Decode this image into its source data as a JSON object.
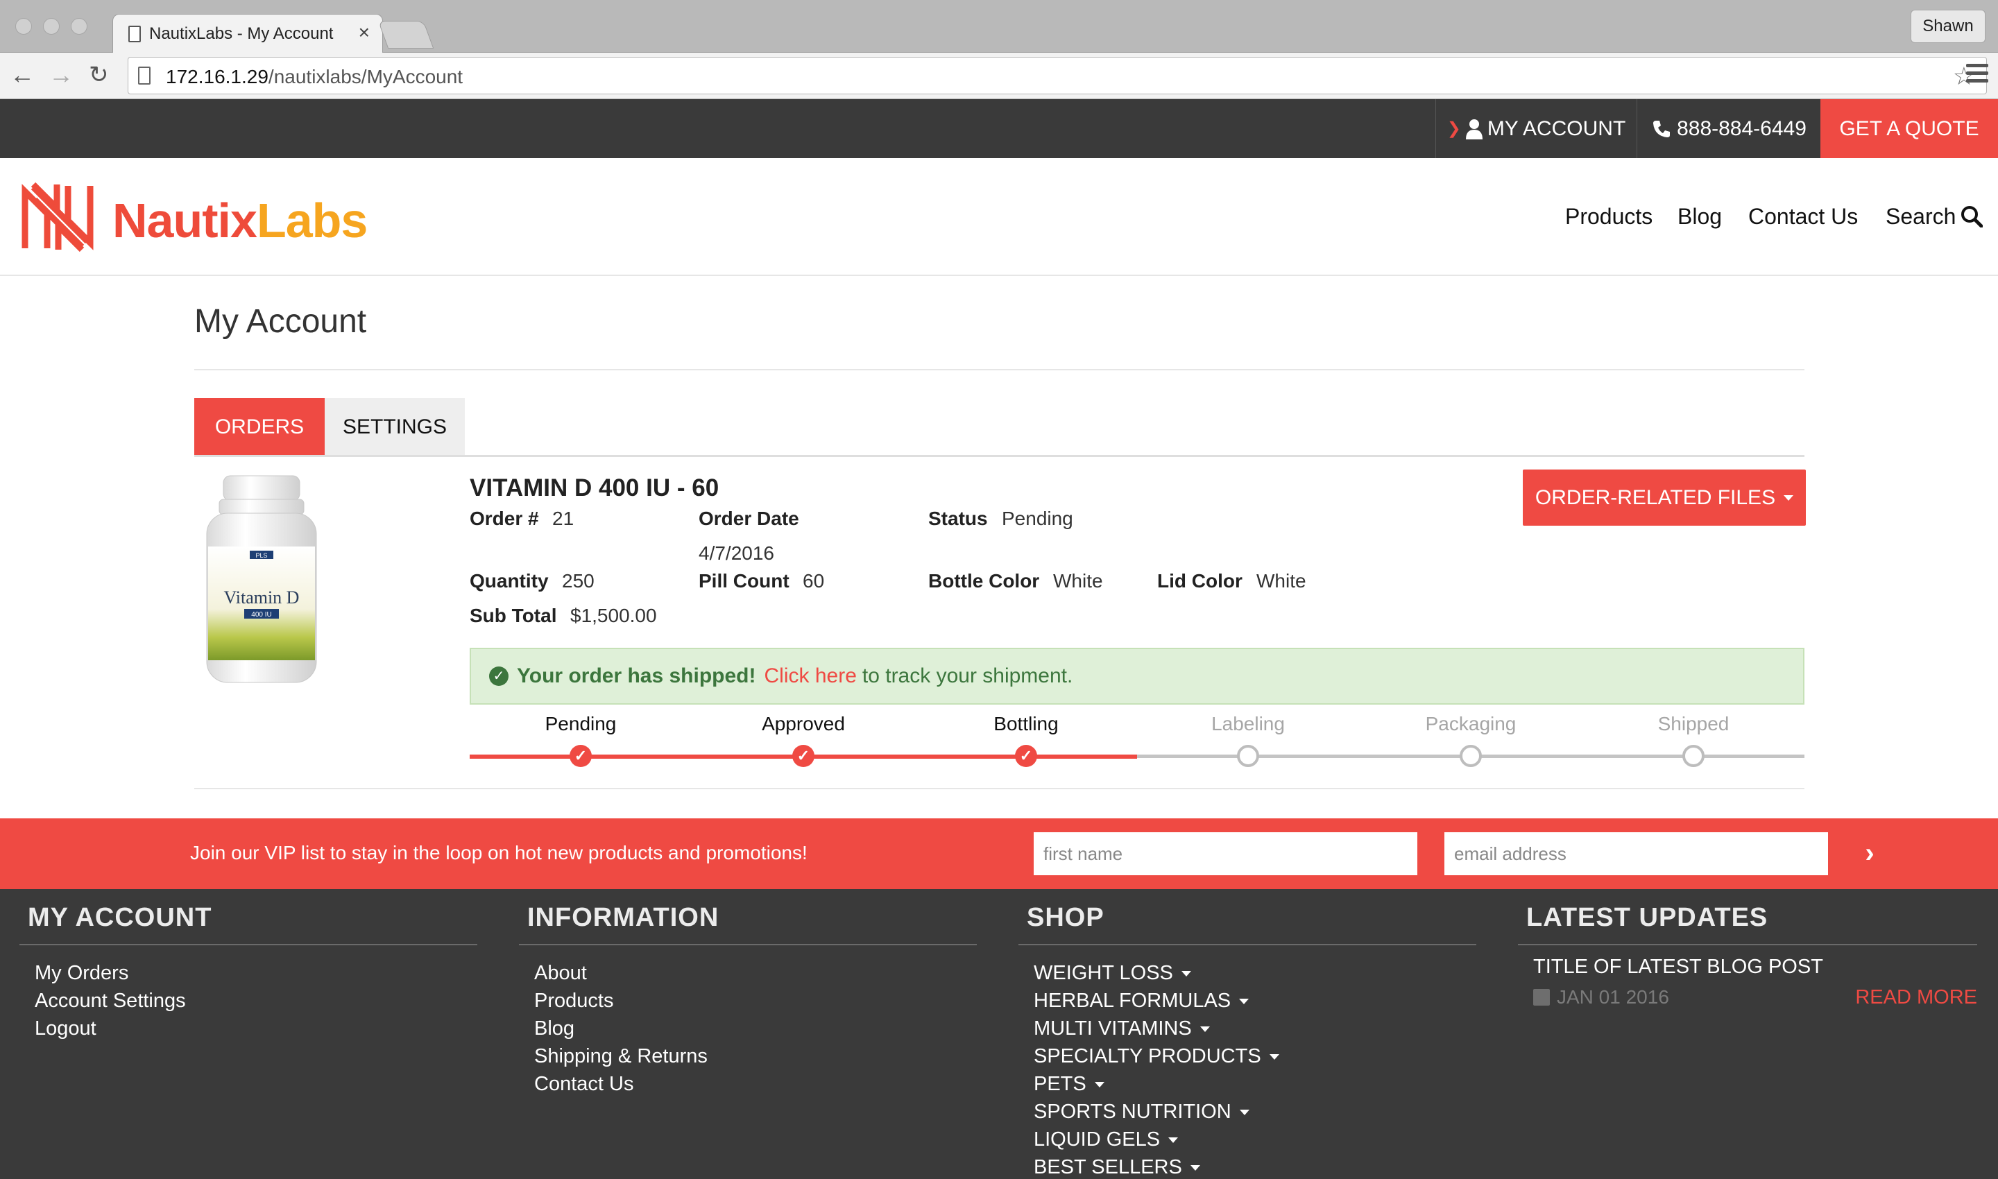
{
  "browser": {
    "tab_title": "NautixLabs - My Account",
    "tab_close": "×",
    "profile_name": "Shawn",
    "url_host": "172.16.1.29",
    "url_path": "/nautixlabs/MyAccount",
    "back_icon": "arrow-left-icon",
    "forward_icon": "arrow-right-icon",
    "reload_icon": "reload-icon",
    "star_icon": "star-icon"
  },
  "topbar": {
    "account_label": "MY ACCOUNT",
    "phone": "888-884-6449",
    "quote_label": "GET A QUOTE"
  },
  "header": {
    "logo_part1": "Nautix",
    "logo_part2": "Labs",
    "nav": {
      "products": "Products",
      "blog": "Blog",
      "contact": "Contact Us",
      "search": "Search"
    }
  },
  "page": {
    "title": "My Account",
    "tabs": {
      "orders": "ORDERS",
      "settings": "SETTINGS"
    }
  },
  "order": {
    "bottle_brand": "PLS",
    "bottle_label": "Vitamin D",
    "bottle_dose": "400 IU",
    "product_name": "VITAMIN D 400 IU - 60",
    "order_no_label": "Order #",
    "order_no": "21",
    "order_date_label": "Order Date",
    "order_date": "4/7/2016",
    "status_label": "Status",
    "status": "Pending",
    "quantity_label": "Quantity",
    "quantity": "250",
    "pill_count_label": "Pill Count",
    "pill_count": "60",
    "bottle_color_label": "Bottle Color",
    "bottle_color": "White",
    "lid_color_label": "Lid Color",
    "lid_color": "White",
    "subtotal_label": "Sub Total",
    "subtotal": "$1,500.00",
    "files_button": "ORDER-RELATED FILES",
    "alert_strong": "Your order has shipped!",
    "alert_link": "Click here",
    "alert_rest": "to track your shipment.",
    "steps": [
      "Pending",
      "Approved",
      "Bottling",
      "Labeling",
      "Packaging",
      "Shipped"
    ],
    "steps_completed": 3
  },
  "vip": {
    "text": "Join our VIP list to stay in the loop on hot new products and promotions!",
    "first_name_placeholder": "first name",
    "email_placeholder": "email address",
    "submit_glyph": "›"
  },
  "footer": {
    "my_account": {
      "heading": "MY ACCOUNT",
      "links": [
        "My Orders",
        "Account Settings",
        "Logout"
      ]
    },
    "information": {
      "heading": "INFORMATION",
      "links": [
        "About",
        "Products",
        "Blog",
        "Shipping & Returns",
        "Contact Us"
      ]
    },
    "shop": {
      "heading": "SHOP",
      "links": [
        "WEIGHT LOSS",
        "HERBAL FORMULAS",
        "MULTI VITAMINS",
        "SPECIALTY PRODUCTS",
        "PETS",
        "SPORTS NUTRITION",
        "LIQUID GELS",
        "BEST SELLERS"
      ]
    },
    "latest": {
      "heading": "LATEST UPDATES",
      "post_title": "TITLE OF LATEST BLOG POST",
      "post_date": "JAN 01 2016",
      "read_more": "READ MORE"
    }
  },
  "colors": {
    "accent": "#ef4a43",
    "dark": "#3a3a3a",
    "logo_orange": "#f6a51f",
    "success_bg": "#dff0d8",
    "success_text": "#3c763d"
  }
}
